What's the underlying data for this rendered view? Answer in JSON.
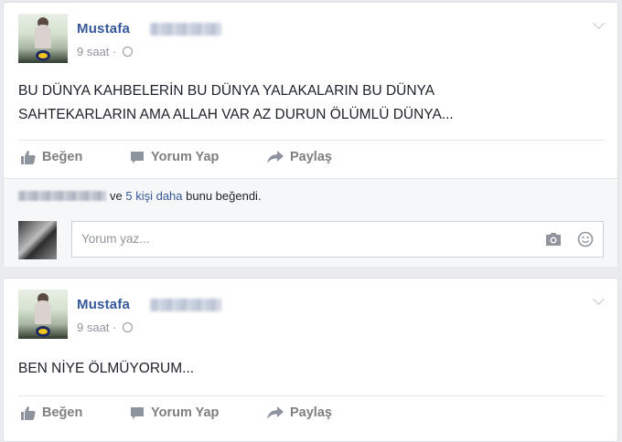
{
  "posts": [
    {
      "author": "Mustafa",
      "time": "9 saat",
      "separator": "·",
      "text": "BU DÜNYA KAHBELERİN BU DÜNYA YALAKALARIN BU DÜNYA\nSAHTEKARLARIN AMA ALLAH VAR AZ DURUN ÖLÜMLÜ DÜNYA...",
      "actions": {
        "like": "Beğen",
        "comment": "Yorum Yap",
        "share": "Paylaş"
      },
      "likes": {
        "middle": "ve",
        "link": "5 kişi daha",
        "suffix": "bunu beğendi."
      },
      "comment_placeholder": "Yorum yaz..."
    },
    {
      "author": "Mustafa",
      "time": "9 saat",
      "separator": "·",
      "text": "BEN NİYE ÖLMÜYORUM...",
      "actions": {
        "like": "Beğen",
        "comment": "Yorum Yap",
        "share": "Paylaş"
      }
    }
  ],
  "icons": [
    "thumbs-up-icon",
    "comment-icon",
    "share-arrow-icon",
    "globe-icon",
    "chevron-down-icon",
    "camera-icon",
    "smiley-icon"
  ],
  "colors": {
    "link": "#365899",
    "background": "#e9ebee",
    "action_gray": "#7f7f7f"
  }
}
